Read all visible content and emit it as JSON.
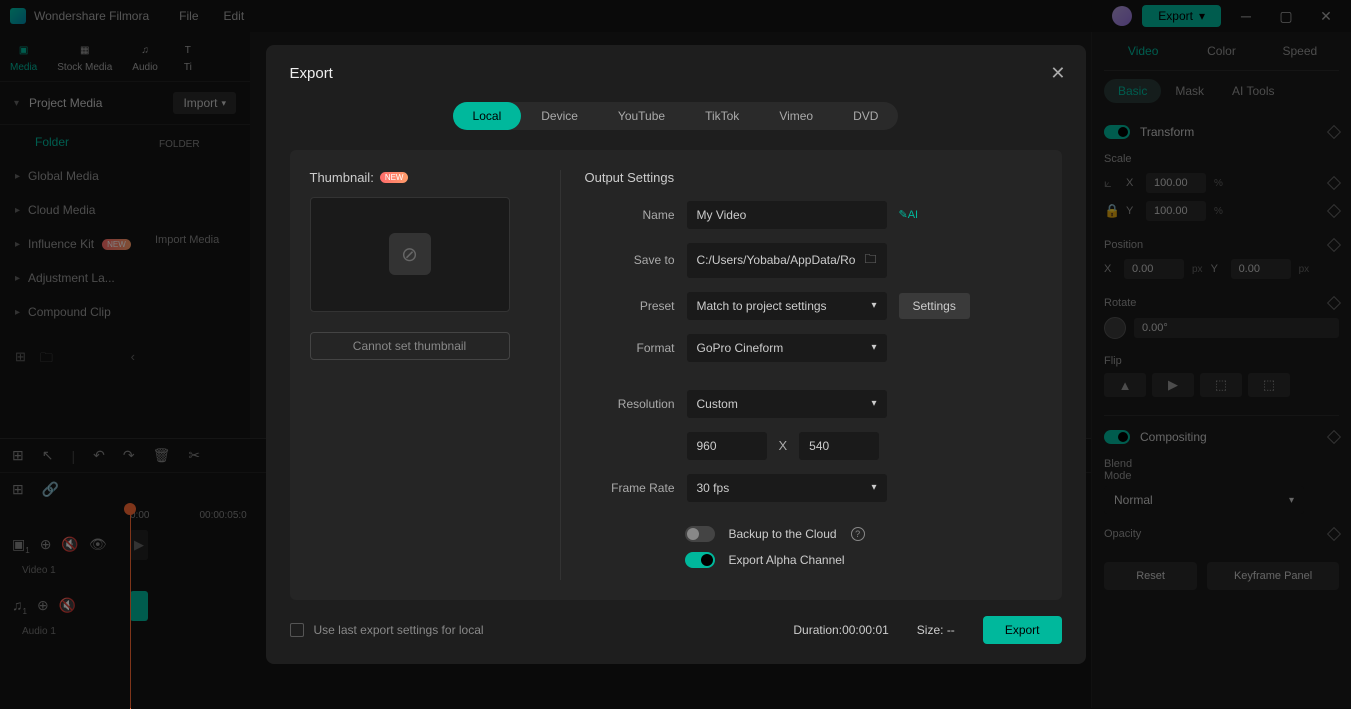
{
  "app": {
    "title": "Wondershare Filmora"
  },
  "menu": {
    "file": "File",
    "edit": "Edit"
  },
  "header": {
    "export": "Export"
  },
  "toolbar": {
    "media": "Media",
    "stock": "Stock Media",
    "audio": "Audio",
    "ti": "Ti"
  },
  "sidebar": {
    "project_media": "Project Media",
    "import": "Import",
    "folder_lbl": "Folder",
    "folder_header": "FOLDER",
    "global": "Global Media",
    "cloud": "Cloud Media",
    "influence": "Influence Kit",
    "adjust": "Adjustment La...",
    "compound": "Compound Clip",
    "import_media": "Import Media",
    "new_badge": "NEW"
  },
  "timeline": {
    "t0": "0:00",
    "t1": "00:00:05:0",
    "video_track": "Video 1",
    "audio_track": "Audio 1"
  },
  "right": {
    "tabs": {
      "video": "Video",
      "color": "Color",
      "speed": "Speed"
    },
    "subtabs": {
      "basic": "Basic",
      "mask": "Mask",
      "ai": "AI Tools"
    },
    "transform": "Transform",
    "scale": "Scale",
    "scale_x": "100.00",
    "scale_y": "100.00",
    "pct": "%",
    "position": "Position",
    "pos_x": "0.00",
    "pos_y": "0.00",
    "px": "px",
    "rotate": "Rotate",
    "rotate_val": "0.00°",
    "flip": "Flip",
    "compositing": "Compositing",
    "blend_mode": "Blend Mode",
    "blend_val": "Normal",
    "opacity": "Opacity",
    "x": "X",
    "y": "Y",
    "reset": "Reset",
    "keyframe": "Keyframe Panel"
  },
  "modal": {
    "title": "Export",
    "tabs": {
      "local": "Local",
      "device": "Device",
      "youtube": "YouTube",
      "tiktok": "TikTok",
      "vimeo": "Vimeo",
      "dvd": "DVD"
    },
    "thumbnail": "Thumbnail:",
    "new_badge": "NEW",
    "cannot_set": "Cannot set thumbnail",
    "output_settings": "Output Settings",
    "name_lbl": "Name",
    "name_val": "My Video",
    "ai_label": "AI",
    "saveto_lbl": "Save to",
    "saveto_val": "C:/Users/Yobaba/AppData/Ro",
    "preset_lbl": "Preset",
    "preset_val": "Match to project settings",
    "settings_btn": "Settings",
    "format_lbl": "Format",
    "format_val": "GoPro Cineform",
    "resolution_lbl": "Resolution",
    "resolution_val": "Custom",
    "res_w": "960",
    "res_h": "540",
    "res_x": "X",
    "framerate_lbl": "Frame Rate",
    "framerate_val": "30 fps",
    "backup": "Backup to the Cloud",
    "alpha": "Export Alpha Channel",
    "use_last": "Use last export settings for local",
    "duration_lbl": "Duration:",
    "duration_val": "00:00:01",
    "size_lbl": "Size: ",
    "size_val": "--",
    "export_btn": "Export"
  }
}
